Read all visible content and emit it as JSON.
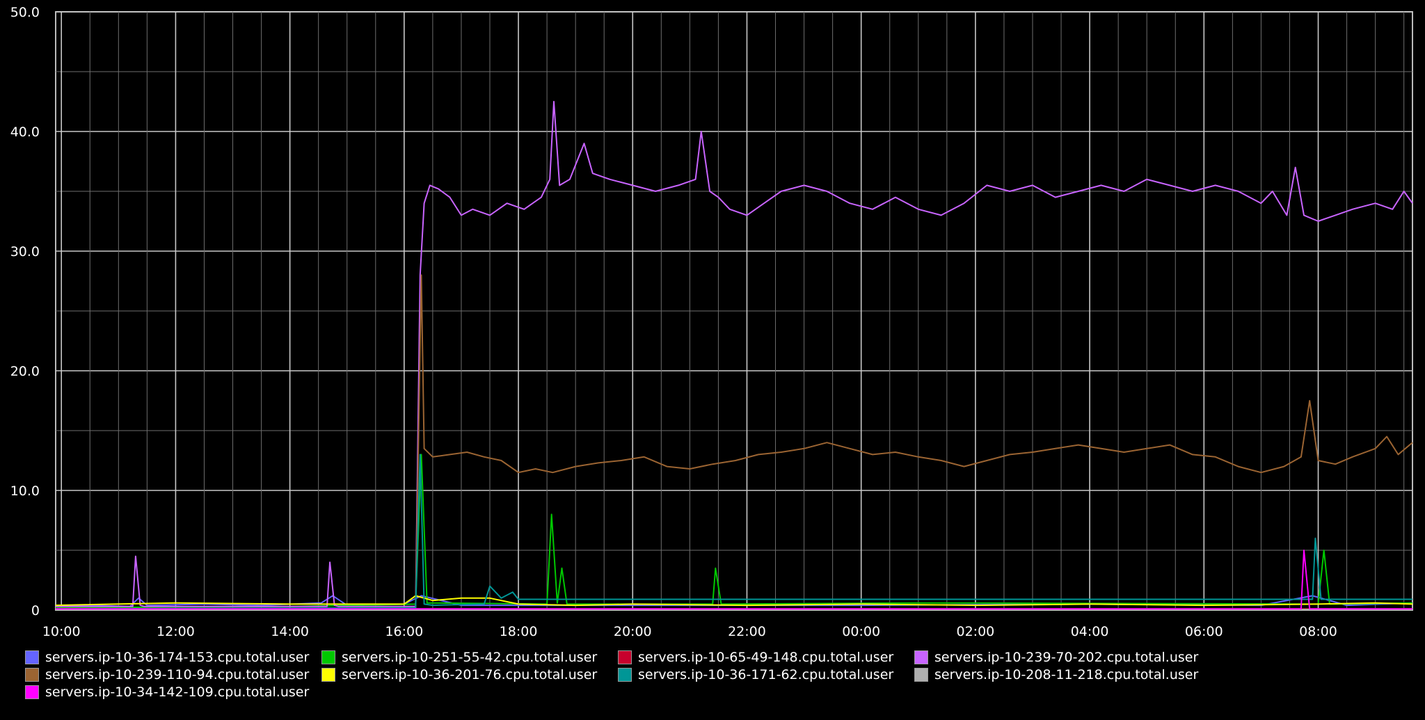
{
  "chart_data": {
    "type": "line",
    "title": "",
    "xlabel": "",
    "ylabel": "",
    "ylim": [
      0,
      50
    ],
    "y_ticks": [
      "50.0",
      "40.0",
      "30.0",
      "20.0",
      "10.0",
      "0"
    ],
    "y_tick_values": [
      50,
      40,
      30,
      20,
      10,
      0
    ],
    "x_range_hours": [
      9.9,
      33.65
    ],
    "x_ticks": [
      "10:00",
      "12:00",
      "14:00",
      "16:00",
      "18:00",
      "20:00",
      "22:00",
      "00:00",
      "02:00",
      "04:00",
      "06:00",
      "08:00"
    ],
    "x_tick_hours": [
      10,
      12,
      14,
      16,
      18,
      20,
      22,
      24,
      26,
      28,
      30,
      32
    ],
    "grid": true,
    "legend_position": "bottom",
    "series": [
      {
        "name": "servers.ip-10-36-174-153.cpu.total.user",
        "color": "#6464ff",
        "x": [
          9.9,
          10.5,
          11.2,
          11.35,
          11.5,
          12.5,
          13.5,
          14.55,
          14.75,
          15.0,
          16.0,
          16.3,
          17.0,
          20.0,
          24.0,
          28.0,
          31.0,
          31.9,
          32.5,
          33.65
        ],
        "y": [
          0.3,
          0.4,
          0.3,
          1.0,
          0.4,
          0.5,
          0.4,
          0.6,
          1.2,
          0.4,
          0.5,
          1.2,
          0.4,
          0.4,
          0.4,
          0.5,
          0.4,
          1.2,
          0.4,
          0.6
        ]
      },
      {
        "name": "servers.ip-10-251-55-42.cpu.total.user",
        "color": "#00c800",
        "x": [
          9.9,
          14.0,
          16.2,
          16.3,
          16.4,
          18.5,
          18.58,
          18.68,
          18.76,
          18.85,
          21.4,
          21.45,
          21.55,
          25.0,
          32.0,
          32.1,
          32.2,
          33.65
        ],
        "y": [
          0.2,
          0.3,
          0.5,
          13.0,
          0.6,
          0.5,
          8.0,
          0.6,
          3.5,
          0.5,
          0.5,
          3.5,
          0.5,
          0.6,
          0.5,
          5.0,
          0.5,
          0.6
        ]
      },
      {
        "name": "servers.ip-10-65-49-148.cpu.total.user",
        "color": "#c8002d",
        "x": [
          9.9,
          33.65
        ],
        "y": [
          0.1,
          0.1
        ]
      },
      {
        "name": "servers.ip-10-239-70-202.cpu.total.user",
        "color": "#c864ff",
        "x": [
          9.9,
          11.25,
          11.3,
          11.38,
          11.45,
          14.65,
          14.7,
          14.78,
          14.85,
          16.2,
          16.28,
          16.35,
          16.45,
          16.6,
          16.8,
          17.0,
          17.2,
          17.5,
          17.8,
          18.1,
          18.4,
          18.55,
          18.62,
          18.72,
          18.9,
          19.15,
          19.3,
          19.6,
          20.0,
          20.4,
          20.8,
          21.1,
          21.2,
          21.35,
          21.5,
          21.7,
          22.0,
          22.3,
          22.6,
          23.0,
          23.4,
          23.8,
          24.2,
          24.6,
          25.0,
          25.4,
          25.8,
          26.2,
          26.6,
          27.0,
          27.4,
          27.8,
          28.2,
          28.6,
          29.0,
          29.4,
          29.8,
          30.2,
          30.6,
          31.0,
          31.2,
          31.45,
          31.6,
          31.75,
          32.0,
          32.3,
          32.6,
          33.0,
          33.3,
          33.5,
          33.65
        ],
        "y": [
          0.3,
          0.3,
          4.5,
          0.4,
          0.3,
          0.3,
          4.0,
          0.4,
          0.3,
          0.3,
          28.0,
          34.0,
          35.5,
          35.2,
          34.5,
          33.0,
          33.5,
          33.0,
          34.0,
          33.5,
          34.5,
          36.0,
          42.5,
          35.5,
          36.0,
          39.0,
          36.5,
          36.0,
          35.5,
          35.0,
          35.5,
          36.0,
          40.0,
          35.0,
          34.5,
          33.5,
          33.0,
          34.0,
          35.0,
          35.5,
          35.0,
          34.0,
          33.5,
          34.5,
          33.5,
          33.0,
          34.0,
          35.5,
          35.0,
          35.5,
          34.5,
          35.0,
          35.5,
          35.0,
          36.0,
          35.5,
          35.0,
          35.5,
          35.0,
          34.0,
          35.0,
          33.0,
          37.0,
          33.0,
          32.5,
          33.0,
          33.5,
          34.0,
          33.5,
          35.0,
          34.0
        ]
      },
      {
        "name": "servers.ip-10-239-110-94.cpu.total.user",
        "color": "#9b6432",
        "x": [
          9.9,
          16.2,
          16.3,
          16.35,
          16.5,
          16.8,
          17.1,
          17.4,
          17.7,
          18.0,
          18.3,
          18.6,
          19.0,
          19.4,
          19.8,
          20.2,
          20.6,
          21.0,
          21.4,
          21.8,
          22.2,
          22.6,
          23.0,
          23.4,
          23.8,
          24.2,
          24.6,
          25.0,
          25.4,
          25.8,
          26.2,
          26.6,
          27.0,
          27.4,
          27.8,
          28.2,
          28.6,
          29.0,
          29.4,
          29.8,
          30.2,
          30.6,
          31.0,
          31.4,
          31.7,
          31.85,
          32.0,
          32.3,
          32.6,
          33.0,
          33.2,
          33.4,
          33.65
        ],
        "y": [
          0.1,
          0.1,
          28.0,
          13.5,
          12.8,
          13.0,
          13.2,
          12.8,
          12.5,
          11.5,
          11.8,
          11.5,
          12.0,
          12.3,
          12.5,
          12.8,
          12.0,
          11.8,
          12.2,
          12.5,
          13.0,
          13.2,
          13.5,
          14.0,
          13.5,
          13.0,
          13.2,
          12.8,
          12.5,
          12.0,
          12.5,
          13.0,
          13.2,
          13.5,
          13.8,
          13.5,
          13.2,
          13.5,
          13.8,
          13.0,
          12.8,
          12.0,
          11.5,
          12.0,
          12.8,
          17.5,
          12.5,
          12.2,
          12.8,
          13.5,
          14.5,
          13.0,
          14.0
        ]
      },
      {
        "name": "servers.ip-10-36-201-76.cpu.total.user",
        "color": "#ffff00",
        "x": [
          9.9,
          12.0,
          14.0,
          16.0,
          16.2,
          16.5,
          17.0,
          17.5,
          18.0,
          19.0,
          20.0,
          22.0,
          24.0,
          26.0,
          28.0,
          30.0,
          32.0,
          33.0,
          33.65
        ],
        "y": [
          0.4,
          0.6,
          0.5,
          0.5,
          1.2,
          0.8,
          1.0,
          1.0,
          0.5,
          0.4,
          0.5,
          0.4,
          0.5,
          0.4,
          0.5,
          0.4,
          0.5,
          0.6,
          0.5
        ]
      },
      {
        "name": "servers.ip-10-36-171-62.cpu.total.user",
        "color": "#009696",
        "x": [
          9.9,
          16.2,
          16.28,
          16.35,
          16.5,
          17.4,
          17.5,
          17.7,
          17.9,
          18.0,
          21.0,
          24.0,
          28.0,
          31.9,
          31.95,
          32.05,
          33.65
        ],
        "y": [
          0.1,
          0.2,
          13.0,
          0.5,
          0.4,
          0.5,
          2.0,
          1.0,
          1.5,
          0.9,
          0.9,
          0.9,
          0.9,
          0.9,
          6.0,
          0.9,
          0.9
        ]
      },
      {
        "name": "servers.ip-10-208-11-218.cpu.total.user",
        "color": "#afafaf",
        "x": [
          9.9,
          33.65
        ],
        "y": [
          0.05,
          0.05
        ]
      },
      {
        "name": "servers.ip-10-34-142-109.cpu.total.user",
        "color": "#ff00ff",
        "x": [
          9.9,
          31.5,
          31.7,
          31.75,
          31.85,
          33.65
        ],
        "y": [
          0.1,
          0.1,
          0.1,
          5.0,
          0.1,
          0.1
        ]
      }
    ]
  }
}
